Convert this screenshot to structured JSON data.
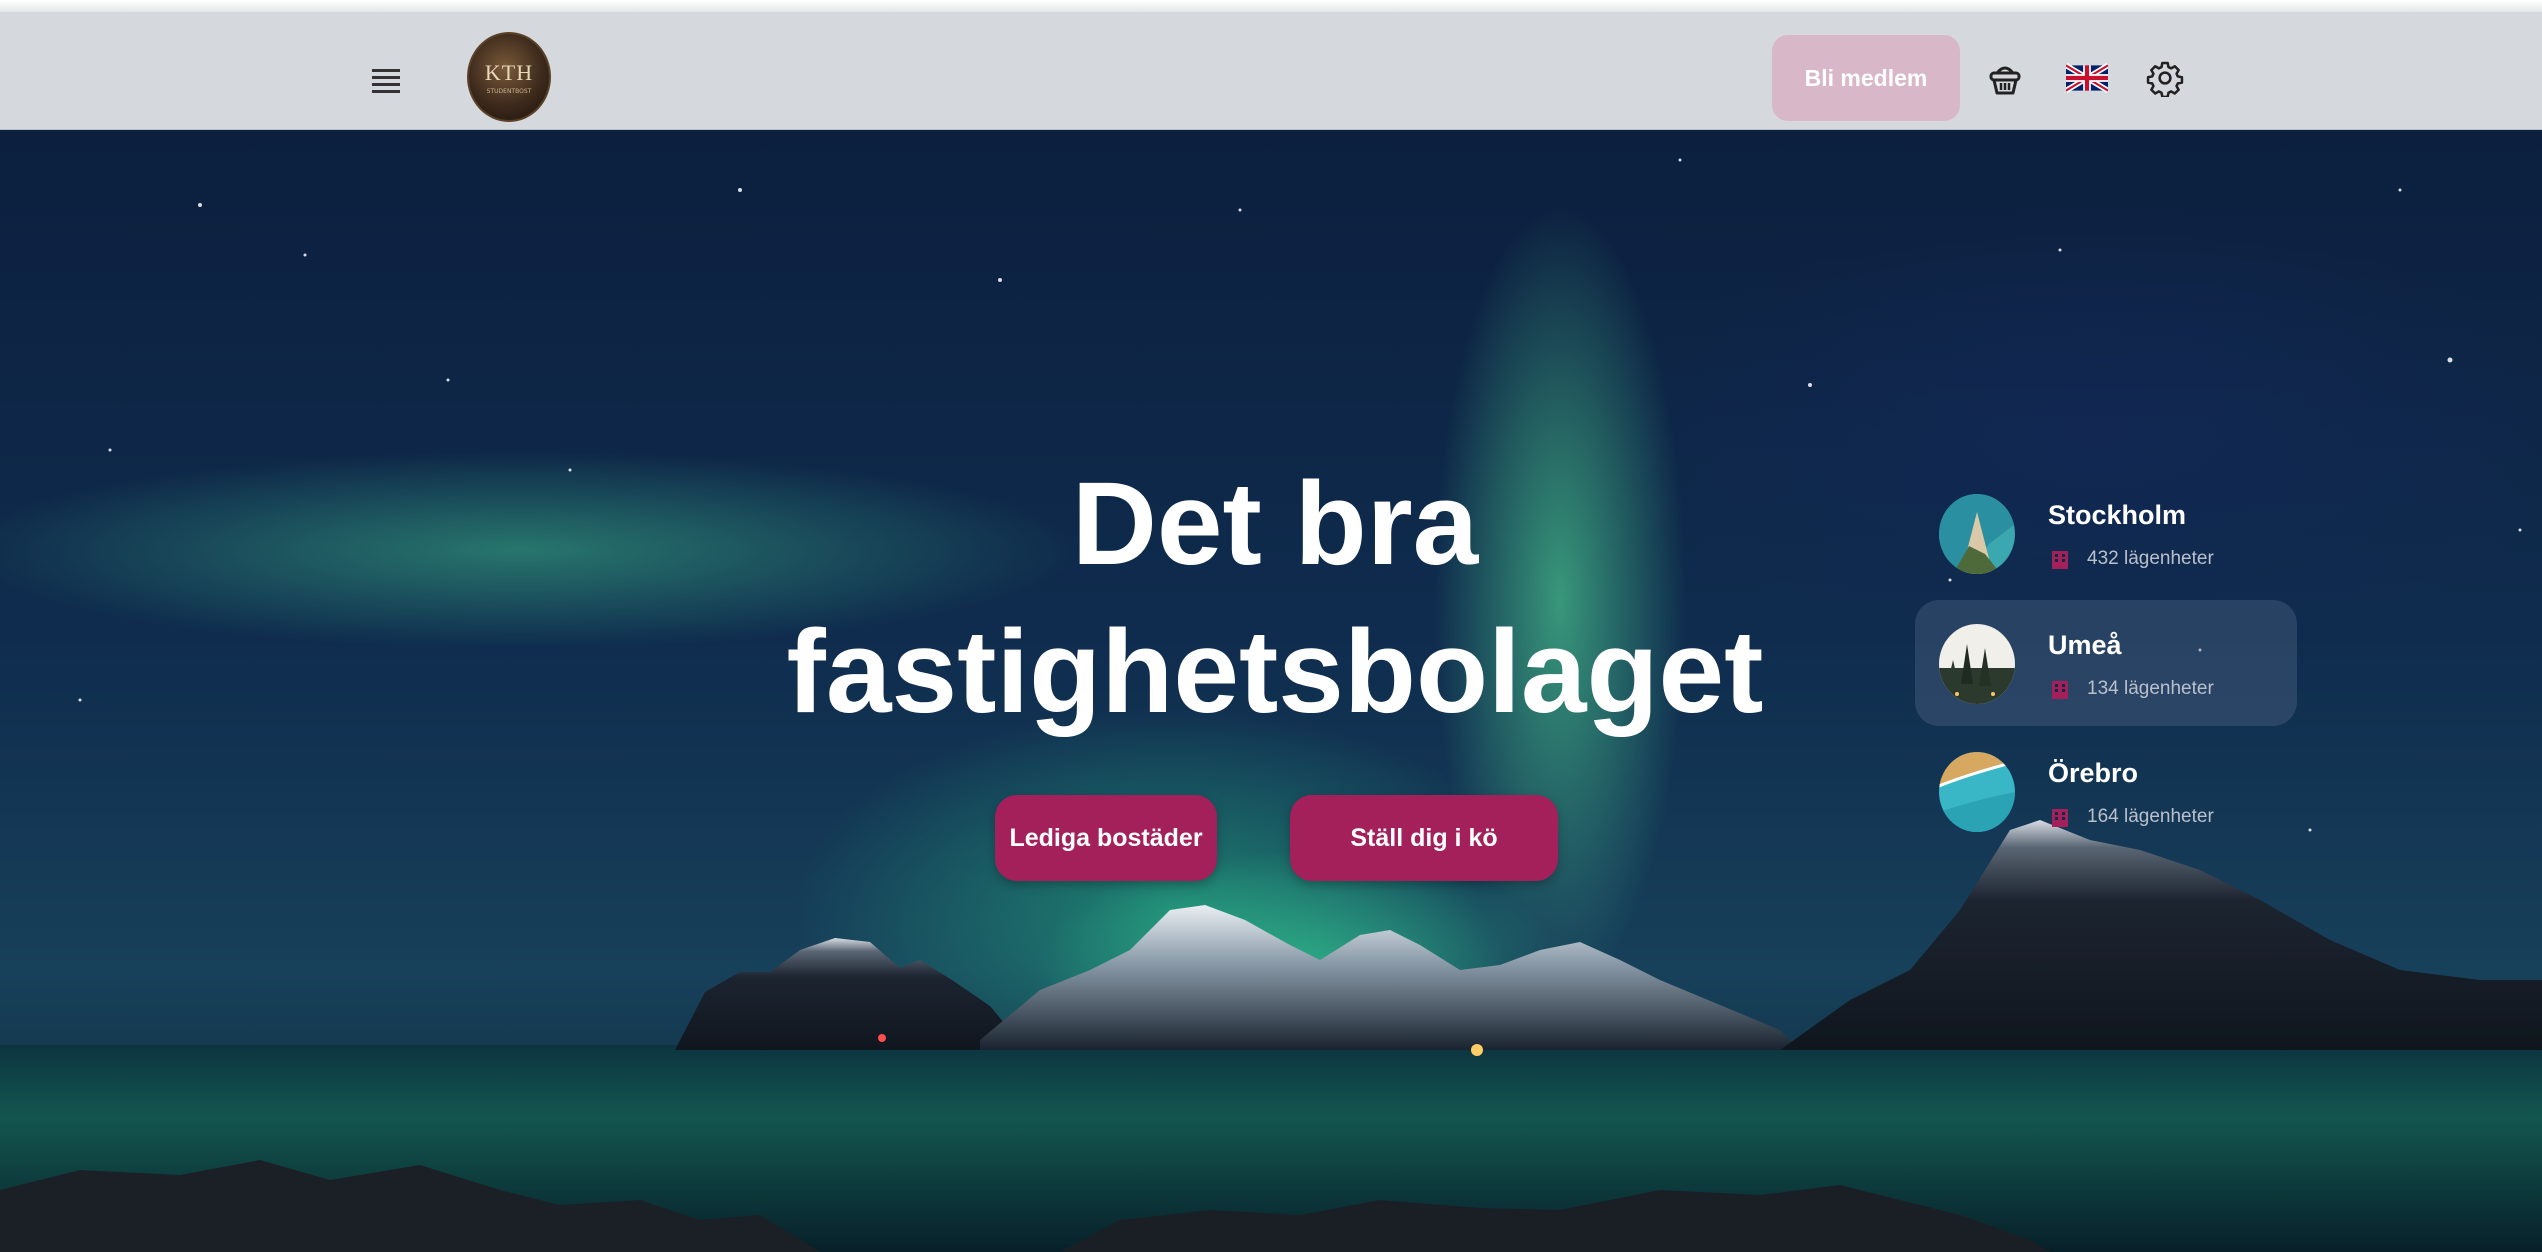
{
  "header": {
    "member_button": "Bli medlem",
    "logo_text": "KTH",
    "logo_subtext": "STUDENTBOST",
    "language": "English",
    "icons": {
      "menu": "hamburger-menu-icon",
      "basket": "basket-icon",
      "flag": "uk-flag-icon",
      "settings": "gear-icon"
    }
  },
  "hero": {
    "title": "Det bra fastighetsbolaget",
    "buttons": {
      "available_label": "Lediga bostäder",
      "queue_label": "Ställ dig i kö"
    }
  },
  "cities": [
    {
      "name": "Stockholm",
      "count": "432 lägenheter",
      "active": false
    },
    {
      "name": "Umeå",
      "count": "134 lägenheter",
      "active": true
    },
    {
      "name": "Örebro",
      "count": "164 lägenheter",
      "active": false
    }
  ],
  "colors": {
    "accent": "#a3205a",
    "member_button": "#d8b8c8",
    "header_bg": "#d5d8dc"
  }
}
